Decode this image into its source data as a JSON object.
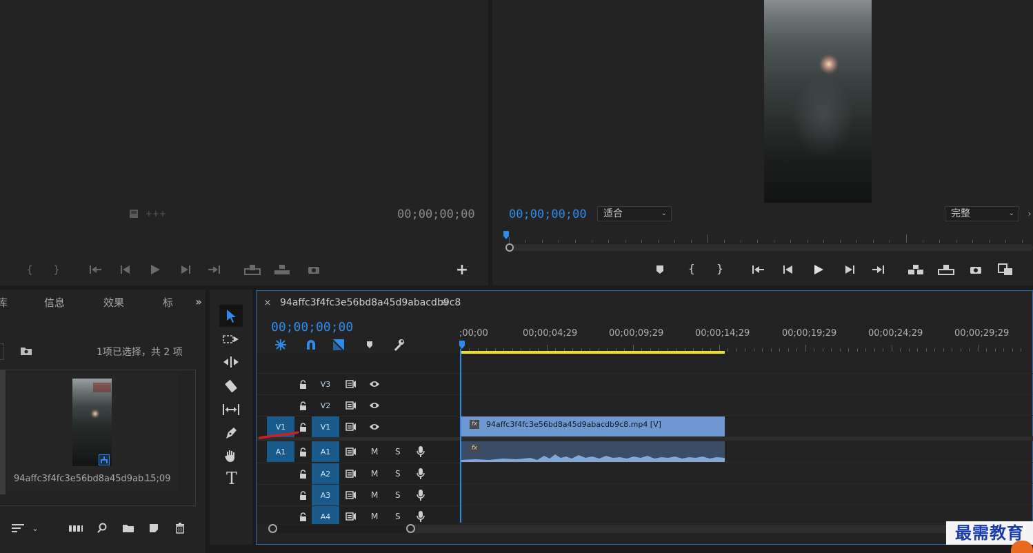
{
  "source_monitor": {
    "timecode": "00;00;00;00"
  },
  "program_monitor": {
    "timecode": "00;00;00;00",
    "fit_dropdown": "适合",
    "quality_dropdown": "完整"
  },
  "project_panel": {
    "tabs": [
      "库",
      "信息",
      "效果",
      "标"
    ],
    "selection_status": "1项已选择，共 2 项",
    "item_name": "94affc3f4fc3e56bd8a45d9ab...",
    "item_duration": "15;09"
  },
  "timeline": {
    "sequence_name": "94affc3f4fc3e56bd8a45d9abacdb9c8",
    "timecode": "00;00;00;00",
    "ruler_labels": [
      ";00;00",
      "00;00;04;29",
      "00;00;09;29",
      "00;00;14;29",
      "00;00;19;29",
      "00;00;24;29",
      "00;00;29;29"
    ],
    "video_tracks": [
      "V3",
      "V2",
      "V1"
    ],
    "audio_tracks": [
      "A1",
      "A2",
      "A3",
      "A4"
    ],
    "source_patch_v": "V1",
    "source_patch_a": "A1",
    "mute_label": "M",
    "solo_label": "S",
    "video_clip_label": "94affc3f4fc3e56bd8a45d9abacdb9c8.mp4 [V]",
    "fx_label": "fx"
  },
  "tools": {
    "type_tool": "T"
  },
  "watermark": {
    "text": "最需教育"
  },
  "colors": {
    "accent_blue": "#2d8ceb",
    "track_patch_blue": "#1a5a8a",
    "video_clip": "#6f97d0",
    "audio_clip": "#3a4c66",
    "work_area_yellow": "#e8e020",
    "annotation_red": "#d0201c"
  }
}
